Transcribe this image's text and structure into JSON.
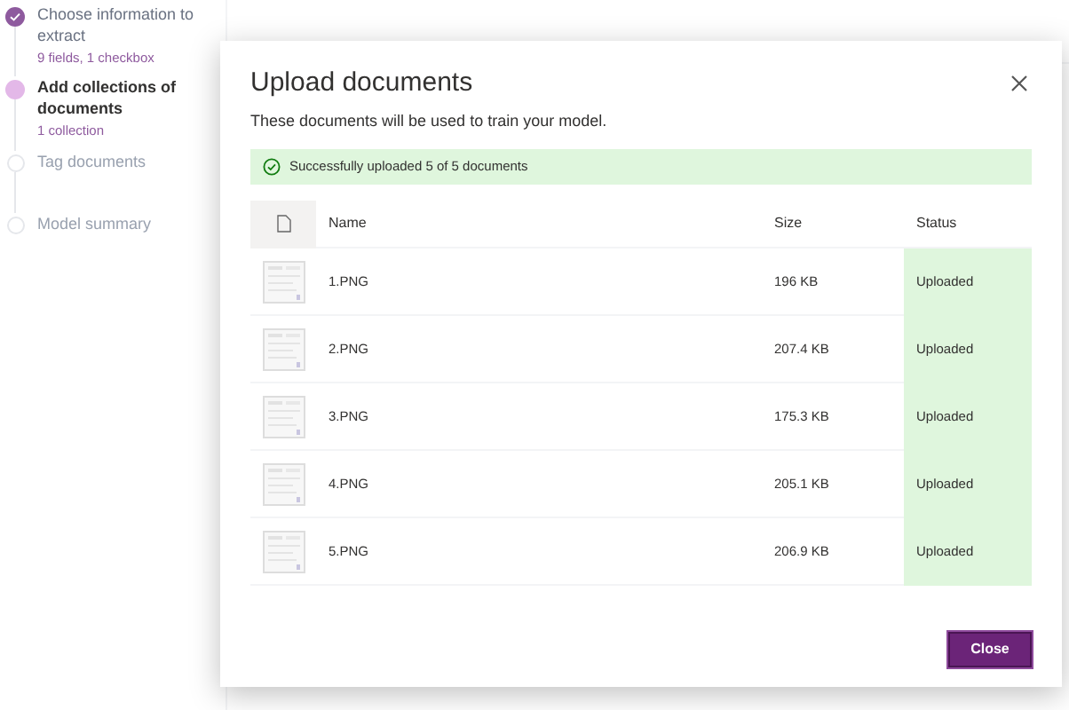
{
  "steps": [
    {
      "title": "Choose information to extract",
      "detail": "9 fields, 1 checkbox",
      "kind": "done"
    },
    {
      "title": "Add collections of documents",
      "detail": "1 collection",
      "kind": "current"
    },
    {
      "title": "Tag documents",
      "kind": "todo"
    },
    {
      "title": "Model summary",
      "kind": "todo"
    }
  ],
  "dialog": {
    "title": "Upload documents",
    "subtitle": "These documents will be used to train your model.",
    "banner": "Successfully uploaded 5 of 5 documents",
    "table": {
      "columns": [
        "Name",
        "Size",
        "Status"
      ],
      "rows": [
        {
          "name": "1.PNG",
          "size": "196 KB",
          "status": "Uploaded"
        },
        {
          "name": "2.PNG",
          "size": "207.4 KB",
          "status": "Uploaded"
        },
        {
          "name": "3.PNG",
          "size": "175.3 KB",
          "status": "Uploaded"
        },
        {
          "name": "4.PNG",
          "size": "205.1 KB",
          "status": "Uploaded"
        },
        {
          "name": "5.PNG",
          "size": "206.9 KB",
          "status": "Uploaded"
        }
      ]
    },
    "close_button": "Close"
  }
}
